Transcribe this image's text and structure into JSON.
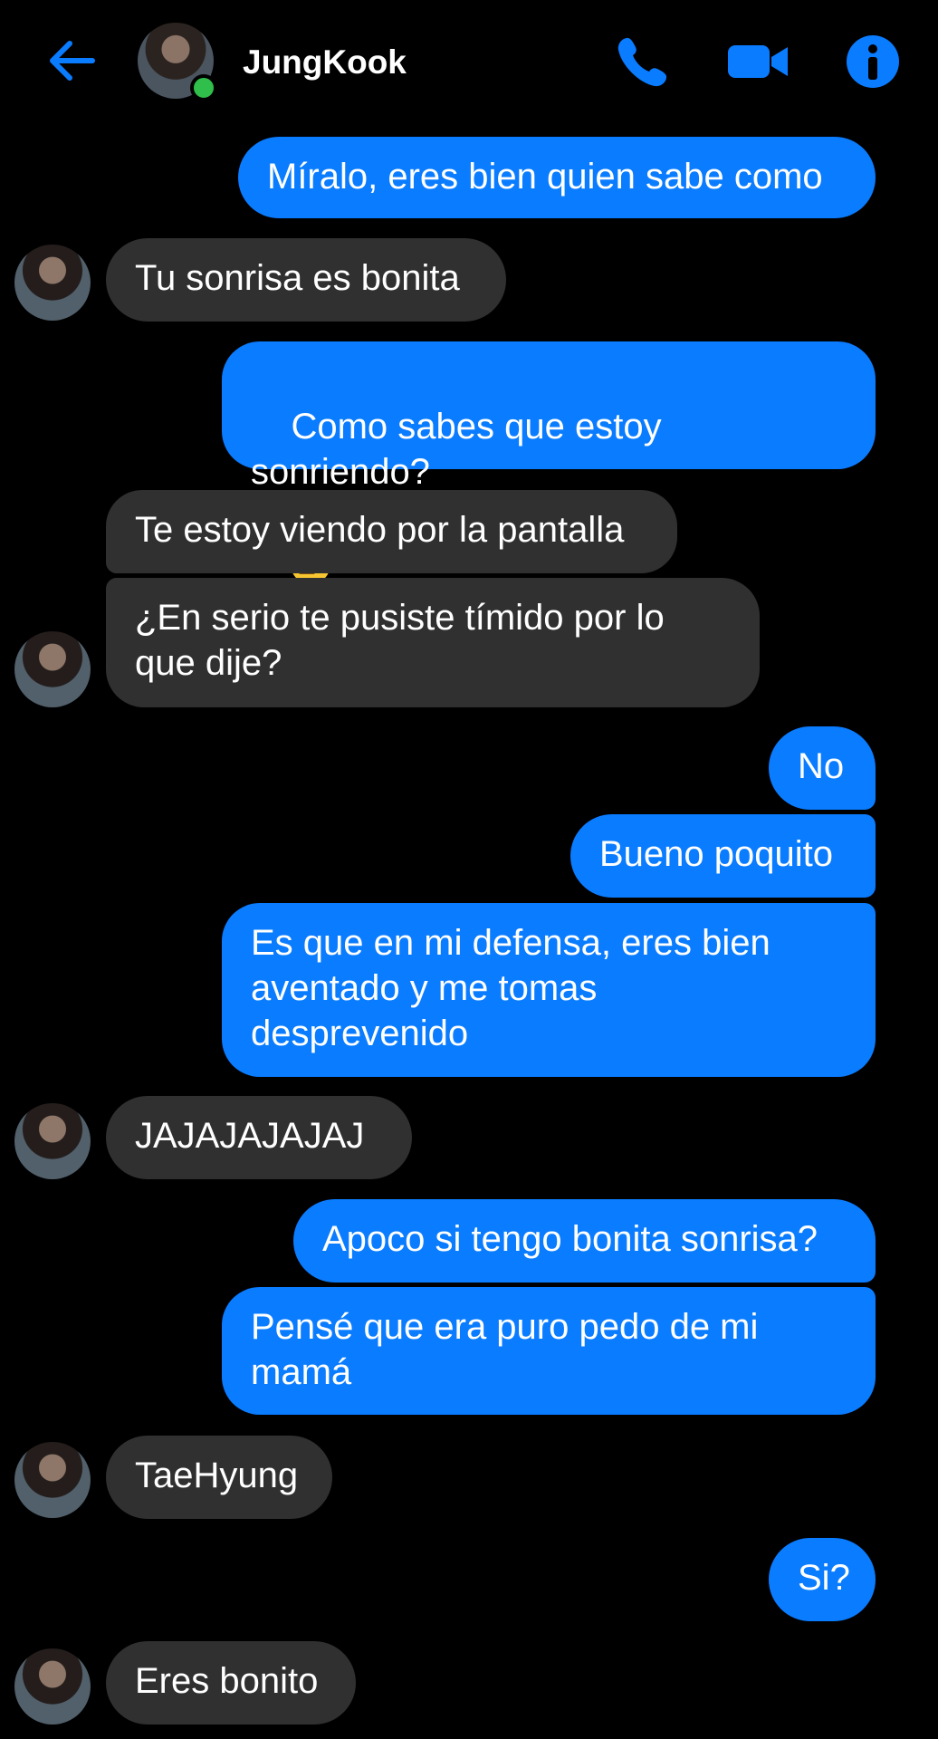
{
  "header": {
    "contact_name": "JungKook",
    "icons": [
      "back-arrow-icon",
      "phone-icon",
      "video-camera-icon",
      "info-icon"
    ],
    "accent": "#0a7cff",
    "online_color": "#2fbf4a"
  },
  "messages": [
    {
      "dir": "out",
      "text": "Míralo, eres bien quien sabe como"
    },
    {
      "dir": "in",
      "text": "Tu sonrisa es bonita"
    },
    {
      "dir": "out",
      "text": "Como sabes que estoy sonriendo?",
      "emoji": "face-with-monocle"
    },
    {
      "dir": "in",
      "text": "Te estoy viendo por la pantalla"
    },
    {
      "dir": "in",
      "text": "¿En serio te pusiste tímido por lo\nque dije?"
    },
    {
      "dir": "out",
      "text": "No"
    },
    {
      "dir": "out",
      "text": "Bueno poquito"
    },
    {
      "dir": "out",
      "text": "Es que en mi defensa, eres bien\naventado y me tomas\ndesprevenido"
    },
    {
      "dir": "in",
      "text": "JAJAJAJAJAJ"
    },
    {
      "dir": "out",
      "text": "Apoco si tengo bonita sonrisa?"
    },
    {
      "dir": "out",
      "text": "Pensé que era puro pedo de mi\nmamá"
    },
    {
      "dir": "in",
      "text": "TaeHyung"
    },
    {
      "dir": "out",
      "text": "Si?"
    },
    {
      "dir": "in",
      "text": "Eres bonito"
    }
  ],
  "colors": {
    "outgoing_bubble": "#0a7cff",
    "incoming_bubble": "#303030",
    "background": "#000000"
  }
}
